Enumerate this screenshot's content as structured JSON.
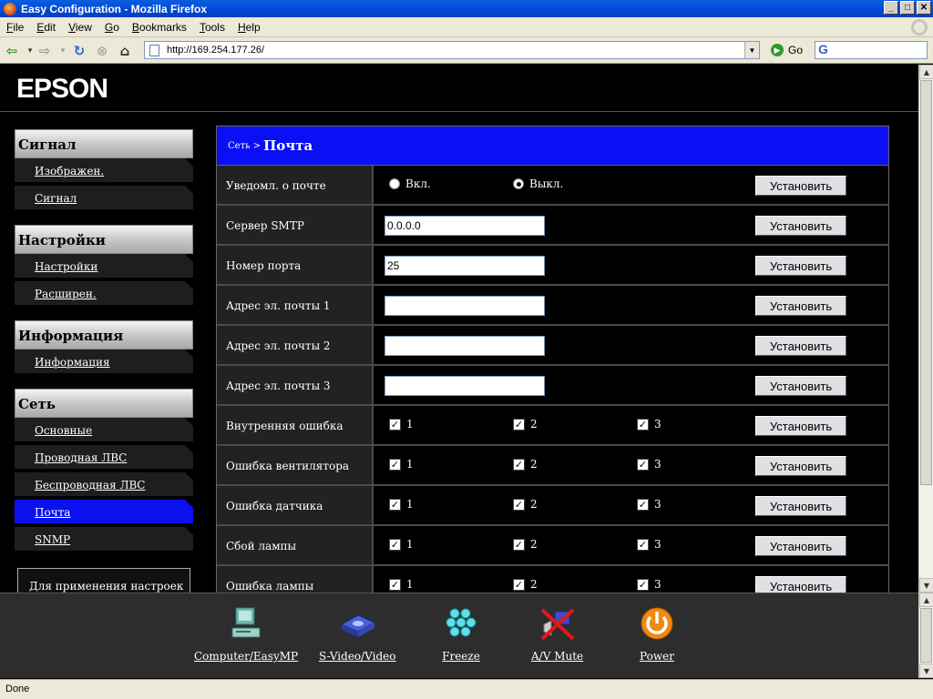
{
  "window": {
    "title": "Easy Configuration - Mozilla Firefox",
    "btn_min": "_",
    "btn_max": "□",
    "btn_close": "✕"
  },
  "menu": [
    "File",
    "Edit",
    "View",
    "Go",
    "Bookmarks",
    "Tools",
    "Help"
  ],
  "nav": {
    "url": "http://169.254.177.26/",
    "go_label": "Go",
    "search_logo": "G"
  },
  "logo": "EPSON",
  "sidebar": {
    "sections": [
      {
        "title": "Сигнал",
        "items": [
          {
            "label": "Изображен."
          },
          {
            "label": "Сигнал"
          }
        ]
      },
      {
        "title": "Настройки",
        "items": [
          {
            "label": "Настройки"
          },
          {
            "label": "Расширен."
          }
        ]
      },
      {
        "title": "Информация",
        "items": [
          {
            "label": "Информация"
          }
        ]
      },
      {
        "title": "Сеть",
        "items": [
          {
            "label": "Основные"
          },
          {
            "label": "Проводная ЛВС"
          },
          {
            "label": "Беспроводная ЛВС"
          },
          {
            "label": "Почта",
            "active": true
          },
          {
            "label": "SNMP"
          }
        ]
      }
    ],
    "apply_note": "Для применения настроек"
  },
  "panel": {
    "breadcrumb": "Сеть >",
    "title": "Почта",
    "set_label": "Установить",
    "rows": [
      {
        "label": "Уведомл. о почте",
        "type": "radio",
        "options": [
          {
            "label": "Вкл.",
            "checked": false
          },
          {
            "label": "Выкл.",
            "checked": true
          }
        ]
      },
      {
        "label": "Сервер SMTP",
        "type": "text",
        "value": "0.0.0.0"
      },
      {
        "label": "Номер порта",
        "type": "text",
        "value": "25"
      },
      {
        "label": "Адрес эл. почты 1",
        "type": "text",
        "value": ""
      },
      {
        "label": "Адрес эл. почты 2",
        "type": "text",
        "value": ""
      },
      {
        "label": "Адрес эл. почты 3",
        "type": "text",
        "value": ""
      },
      {
        "label": "Внутренняя ошибка",
        "type": "check",
        "checks": [
          {
            "label": "1",
            "checked": true
          },
          {
            "label": "2",
            "checked": true
          },
          {
            "label": "3",
            "checked": true
          }
        ]
      },
      {
        "label": "Ошибка вентилятора",
        "type": "check",
        "checks": [
          {
            "label": "1",
            "checked": true
          },
          {
            "label": "2",
            "checked": true
          },
          {
            "label": "3",
            "checked": true
          }
        ]
      },
      {
        "label": "Ошибка датчика",
        "type": "check",
        "checks": [
          {
            "label": "1",
            "checked": true
          },
          {
            "label": "2",
            "checked": true
          },
          {
            "label": "3",
            "checked": true
          }
        ]
      },
      {
        "label": "Сбой лампы",
        "type": "check",
        "checks": [
          {
            "label": "1",
            "checked": true
          },
          {
            "label": "2",
            "checked": true
          },
          {
            "label": "3",
            "checked": true
          }
        ]
      },
      {
        "label": "Ошибка лампы",
        "type": "check",
        "checks": [
          {
            "label": "1",
            "checked": true
          },
          {
            "label": "2",
            "checked": true
          },
          {
            "label": "3",
            "checked": true
          }
        ]
      }
    ]
  },
  "controls": [
    {
      "label": "Computer/EasyMP",
      "icon": "computer-icon"
    },
    {
      "label": "S-Video/Video",
      "icon": "video-device-icon"
    },
    {
      "label": "Freeze",
      "icon": "freeze-icon"
    },
    {
      "label": "A/V Mute",
      "icon": "av-mute-icon"
    },
    {
      "label": "Power",
      "icon": "power-icon"
    }
  ],
  "status": "Done"
}
